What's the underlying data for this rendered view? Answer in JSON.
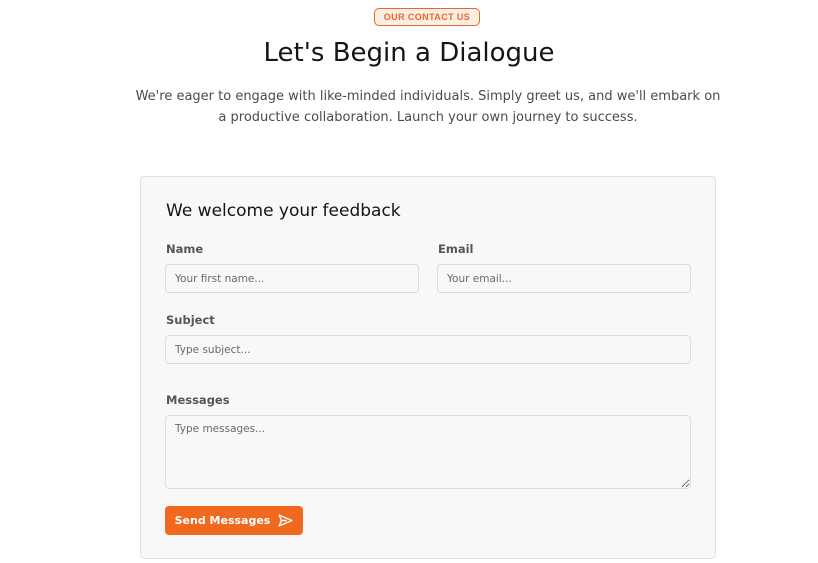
{
  "header": {
    "badge": "OUR CONTACT US",
    "title": "Let's Begin a Dialogue",
    "subtitle": "We're eager to engage with like-minded individuals. Simply greet us, and we'll embark on a productive collaboration. Launch your own journey to success."
  },
  "form": {
    "title": "We welcome your feedback",
    "name": {
      "label": "Name",
      "placeholder": "Your first name...",
      "value": ""
    },
    "email": {
      "label": "Email",
      "placeholder": "Your email...",
      "value": ""
    },
    "subject": {
      "label": "Subject",
      "placeholder": "Type subject...",
      "value": ""
    },
    "messages": {
      "label": "Messages",
      "placeholder": "Type messages...",
      "value": ""
    },
    "send_label": "Send Messages",
    "send_icon": "send-icon"
  },
  "colors": {
    "accent": "#f0691f",
    "badge_border": "#e9672a",
    "card_background": "#f8f8f8"
  }
}
